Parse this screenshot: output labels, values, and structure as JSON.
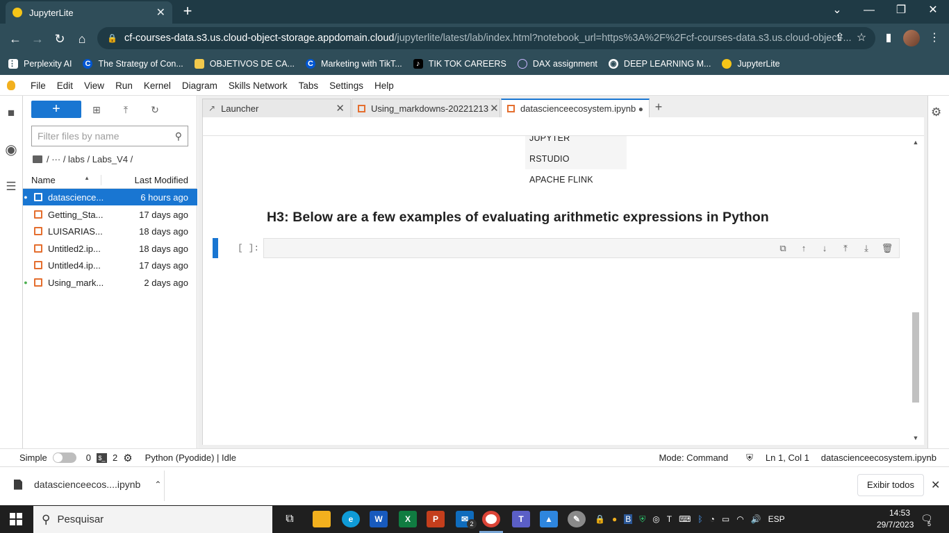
{
  "browser": {
    "tab_title": "JupyterLite",
    "tab_close": "✕",
    "new_tab": "+",
    "window_controls": [
      "⌄",
      "—",
      "❐",
      "✕"
    ],
    "url_domain": "cf-courses-data.s3.us.cloud-object-storage.appdomain.cloud",
    "url_path": "/jupyterlite/latest/lab/index.html?notebook_url=https%3A%2F%2Fcf-courses-data.s3.us.cloud-object-...",
    "bookmarks": [
      {
        "label": "Perplexity AI",
        "icon": "apps-grid-icon"
      },
      {
        "label": "The Strategy of Con...",
        "icon": "coursera-icon"
      },
      {
        "label": "OBJETIVOS DE CA...",
        "icon": "folder-icon"
      },
      {
        "label": "Marketing with TikT...",
        "icon": "coursera-icon"
      },
      {
        "label": "TIK TOK CAREERS",
        "icon": "tiktok-icon"
      },
      {
        "label": "DAX assignment",
        "icon": "globe-icon"
      },
      {
        "label": "DEEP LEARNING M...",
        "icon": "chrome-icon"
      },
      {
        "label": "JupyterLite",
        "icon": "jupyter-icon"
      }
    ]
  },
  "jupyter": {
    "menu": [
      "File",
      "Edit",
      "View",
      "Run",
      "Kernel",
      "Diagram",
      "Skills Network",
      "Tabs",
      "Settings",
      "Help"
    ],
    "filebrowser": {
      "new_label": "+",
      "filter_placeholder": "Filter files by name",
      "breadcrumb": "/ ··· / labs / Labs_V4 /",
      "col_name": "Name",
      "col_modified": "Last Modified",
      "sort_icon": "▲",
      "files": [
        {
          "name": "datascience...",
          "modified": "6 hours ago",
          "running": true,
          "selected": true
        },
        {
          "name": "Getting_Sta...",
          "modified": "17 days ago",
          "running": false,
          "selected": false
        },
        {
          "name": "LUISARIAS...",
          "modified": "18 days ago",
          "running": false,
          "selected": false
        },
        {
          "name": "Untitled2.ip...",
          "modified": "18 days ago",
          "running": false,
          "selected": false
        },
        {
          "name": "Untitled4.ip...",
          "modified": "17 days ago",
          "running": false,
          "selected": false
        },
        {
          "name": "Using_mark...",
          "modified": "2 days ago",
          "running": true,
          "selected": false
        }
      ]
    },
    "doc_tabs": [
      {
        "label": "Launcher",
        "close": "✕"
      },
      {
        "label": "Using_markdowns-20221213",
        "close": "✕"
      },
      {
        "label": "datascienceecosystem.ipynb",
        "close": "●"
      }
    ],
    "add_tab": "+",
    "cell_type": "Code",
    "kernel_name": "Python (Pyodide)",
    "table_rows": [
      "JUPYTER",
      "RSTUDIO",
      "APACHE FLINK"
    ],
    "heading": "H3: Below are a few examples of evaluating arithmetic expressions in Python",
    "prompt": "[ ]:",
    "status": {
      "simple": "Simple",
      "terminals": "0",
      "kernels": "2",
      "kernel_status": "Python (Pyodide) | Idle",
      "mode": "Mode: Command",
      "position": "Ln 1, Col 1",
      "filename": "datascienceecosystem.ipynb"
    }
  },
  "downloads": {
    "file": "datascienceecos....ipynb",
    "show_all": "Exibir todos",
    "close": "✕"
  },
  "taskbar": {
    "search": "Pesquisar",
    "lang": "ESP",
    "time": "14:53",
    "date": "29/7/2023",
    "mail_badge": "2",
    "notif_badge": "5"
  },
  "colors": {
    "accent": "#1976d2",
    "chrome_dark": "#1f3a45",
    "chrome": "#2f4d59",
    "notebook_icon": "#e46e2e"
  }
}
